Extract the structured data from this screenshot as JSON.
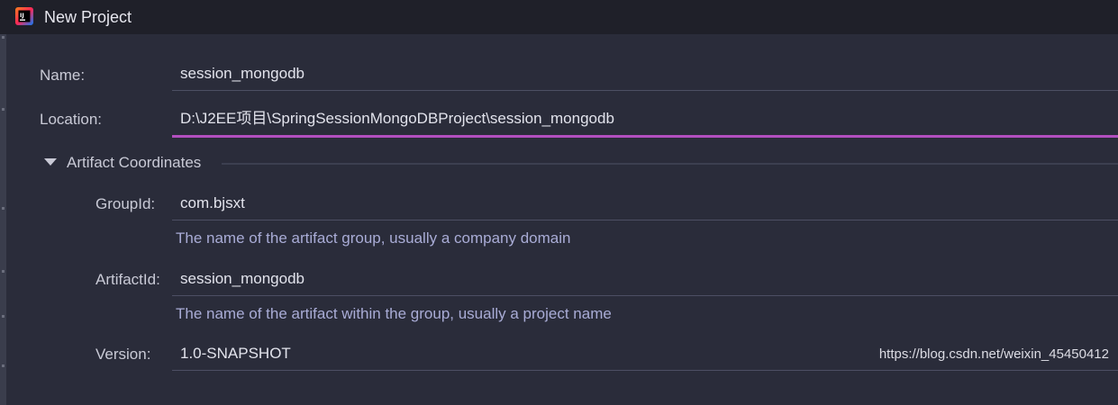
{
  "window": {
    "title": "New Project",
    "icon": "intellij-idea-icon"
  },
  "form": {
    "name": {
      "label": "Name:",
      "value": "session_mongodb"
    },
    "location": {
      "label": "Location:",
      "value": "D:\\J2EE项目\\SpringSessionMongoDBProject\\session_mongodb"
    },
    "artifact_section": {
      "title": "Artifact Coordinates",
      "expanded": true,
      "group_id": {
        "label": "GroupId:",
        "value": "com.bjsxt",
        "hint": "The name of the artifact group, usually a company domain"
      },
      "artifact_id": {
        "label": "ArtifactId:",
        "value": "session_mongodb",
        "hint": "The name of the artifact within the group, usually a project name"
      },
      "version": {
        "label": "Version:",
        "value": "1.0-SNAPSHOT"
      }
    }
  },
  "watermark": "https://blog.csdn.net/weixin_45450412",
  "colors": {
    "background": "#2a2c3a",
    "titlebar": "#1f2029",
    "focus_accent": "#b24fbf",
    "hint_text": "#a9acd6"
  }
}
